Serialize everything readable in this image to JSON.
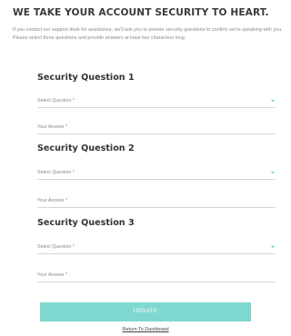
{
  "header": {
    "title": "WE TAKE YOUR ACCOUNT SECURITY TO HEART.",
    "intro_line1": "If you contact our support desk for assistance, we'll ask you to answer security questions to confirm we're speaking with you.",
    "intro_line2": "Please select three questions and provide answers at least two characters long."
  },
  "questions": [
    {
      "title": "Security Question 1",
      "select_placeholder": "Select Question *",
      "answer_placeholder": "Your Answer *",
      "select_value": "",
      "answer_value": ""
    },
    {
      "title": "Security Question 2",
      "select_placeholder": "Select Question *",
      "answer_placeholder": "Your Answer *",
      "select_value": "",
      "answer_value": ""
    },
    {
      "title": "Security Question 3",
      "select_placeholder": "Select Question *",
      "answer_placeholder": "Your Answer *",
      "select_value": "",
      "answer_value": ""
    }
  ],
  "actions": {
    "update_label": "UPDATE",
    "return_label": "Return To Dashboard"
  },
  "colors": {
    "accent": "#7fd8cf",
    "caret": "#5fc8be",
    "title_text": "#3a3a3a",
    "muted_text": "#8a8a8a"
  },
  "icons": {
    "dropdown": "chevron-down-icon"
  }
}
